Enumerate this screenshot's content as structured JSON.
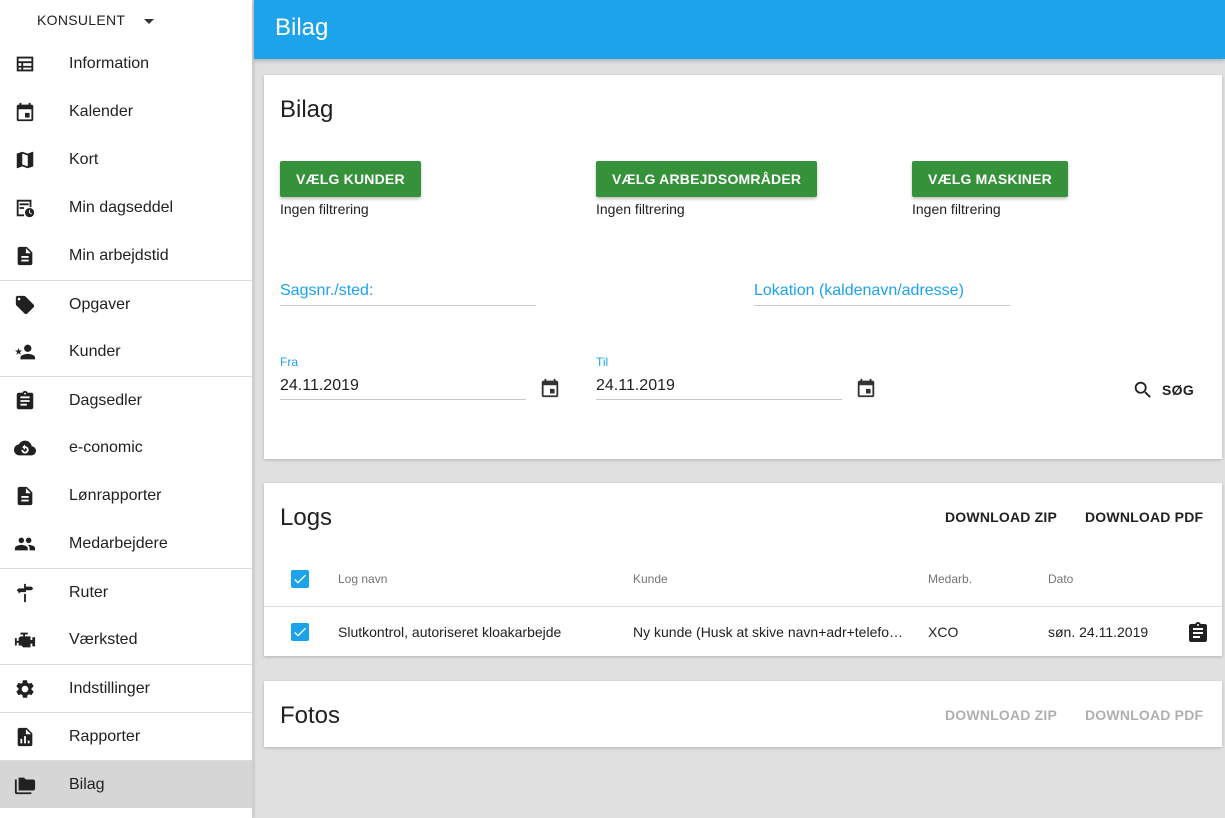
{
  "sidebar": {
    "role": "KONSULENT",
    "items": [
      {
        "label": "Information"
      },
      {
        "label": "Kalender"
      },
      {
        "label": "Kort"
      },
      {
        "label": "Min dagseddel"
      },
      {
        "label": "Min arbejdstid"
      },
      {
        "label": "Opgaver"
      },
      {
        "label": "Kunder"
      },
      {
        "label": "Dagsedler"
      },
      {
        "label": "e-conomic"
      },
      {
        "label": "Lønrapporter"
      },
      {
        "label": "Medarbejdere"
      },
      {
        "label": "Ruter"
      },
      {
        "label": "Værksted"
      },
      {
        "label": "Indstillinger"
      },
      {
        "label": "Rapporter"
      },
      {
        "label": "Bilag"
      }
    ]
  },
  "header": {
    "title": "Bilag"
  },
  "filter_card": {
    "title": "Bilag",
    "btn_customers": "VÆLG KUNDER",
    "btn_areas": "VÆLG ARBEJDSOMRÅDER",
    "btn_machines": "VÆLG MASKINER",
    "no_filter_1": "Ingen filtrering",
    "no_filter_2": "Ingen filtrering",
    "no_filter_3": "Ingen filtrering",
    "case_label": "Sagsnr./sted:",
    "location_label": "Lokation (kaldenavn/adresse)",
    "from_label": "Fra",
    "from_value": "24.11.2019",
    "to_label": "Til",
    "to_value": "24.11.2019",
    "search_label": "SØG"
  },
  "logs_card": {
    "title": "Logs",
    "download_zip": "DOWNLOAD ZIP",
    "download_pdf": "DOWNLOAD PDF",
    "columns": {
      "name": "Log navn",
      "customer": "Kunde",
      "employee": "Medarb.",
      "date": "Dato"
    },
    "rows": [
      {
        "name": "Slutkontrol, autoriseret kloakarbejde",
        "customer": "Ny kunde (Husk at skive navn+adr+telefo…",
        "employee": "XCO",
        "date": "søn. 24.11.2019",
        "checked": true
      }
    ]
  },
  "photos_card": {
    "title": "Fotos",
    "download_zip": "DOWNLOAD ZIP",
    "download_pdf": "DOWNLOAD PDF"
  },
  "colors": {
    "accent": "#1ca3ec",
    "green": "#36913b",
    "active_nav": "#d6d6d6"
  }
}
